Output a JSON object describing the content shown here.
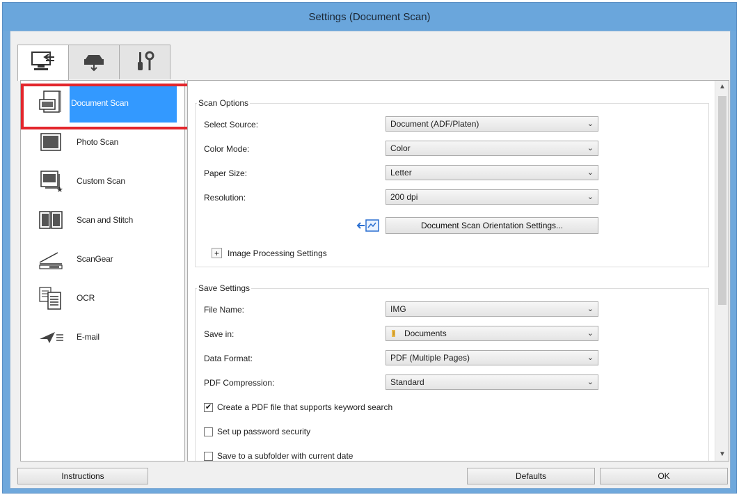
{
  "window": {
    "title": "Settings (Document Scan)"
  },
  "tabs": [
    {
      "name": "scan-from-computer",
      "icon": "computer-scan-icon",
      "active": true
    },
    {
      "name": "scan-from-panel",
      "icon": "scanner-icon",
      "active": false
    },
    {
      "name": "general-settings",
      "icon": "tools-icon",
      "active": false
    }
  ],
  "sidebar": {
    "items": [
      {
        "label": "Document Scan",
        "icon": "pdf-document-icon",
        "selected": true
      },
      {
        "label": "Photo Scan",
        "icon": "photo-icon"
      },
      {
        "label": "Custom Scan",
        "icon": "custom-scan-icon"
      },
      {
        "label": "Scan and Stitch",
        "icon": "stitch-icon"
      },
      {
        "label": "ScanGear",
        "icon": "scangear-icon"
      },
      {
        "label": "OCR",
        "icon": "ocr-icon"
      },
      {
        "label": "E-mail",
        "icon": "email-icon"
      }
    ]
  },
  "scan_options": {
    "title": "Scan Options",
    "select_source": {
      "label": "Select Source:",
      "value": "Document (ADF/Platen)"
    },
    "color_mode": {
      "label": "Color Mode:",
      "value": "Color"
    },
    "paper_size": {
      "label": "Paper Size:",
      "value": "Letter"
    },
    "resolution": {
      "label": "Resolution:",
      "value": "200 dpi"
    },
    "orientation_button": "Document Scan Orientation Settings...",
    "image_processing": "Image Processing Settings",
    "expand_symbol": "+"
  },
  "save_settings": {
    "title": "Save Settings",
    "file_name": {
      "label": "File Name:",
      "value": "IMG"
    },
    "save_in": {
      "label": "Save in:",
      "value": "Documents"
    },
    "data_format": {
      "label": "Data Format:",
      "value": "PDF (Multiple Pages)"
    },
    "pdf_compression": {
      "label": "PDF Compression:",
      "value": "Standard"
    },
    "checkboxes": [
      {
        "label": "Create a PDF file that supports keyword search",
        "checked": true
      },
      {
        "label": "Set up password security",
        "checked": false
      },
      {
        "label": "Save to a subfolder with current date",
        "checked": false
      }
    ]
  },
  "footer": {
    "instructions": "Instructions",
    "defaults": "Defaults",
    "ok": "OK"
  },
  "glyphs": {
    "chevron": "⌄",
    "check": "✔"
  },
  "colors": {
    "title_bar": "#6aa6dc",
    "selection": "#3399ff",
    "highlight": "#e3262c"
  }
}
